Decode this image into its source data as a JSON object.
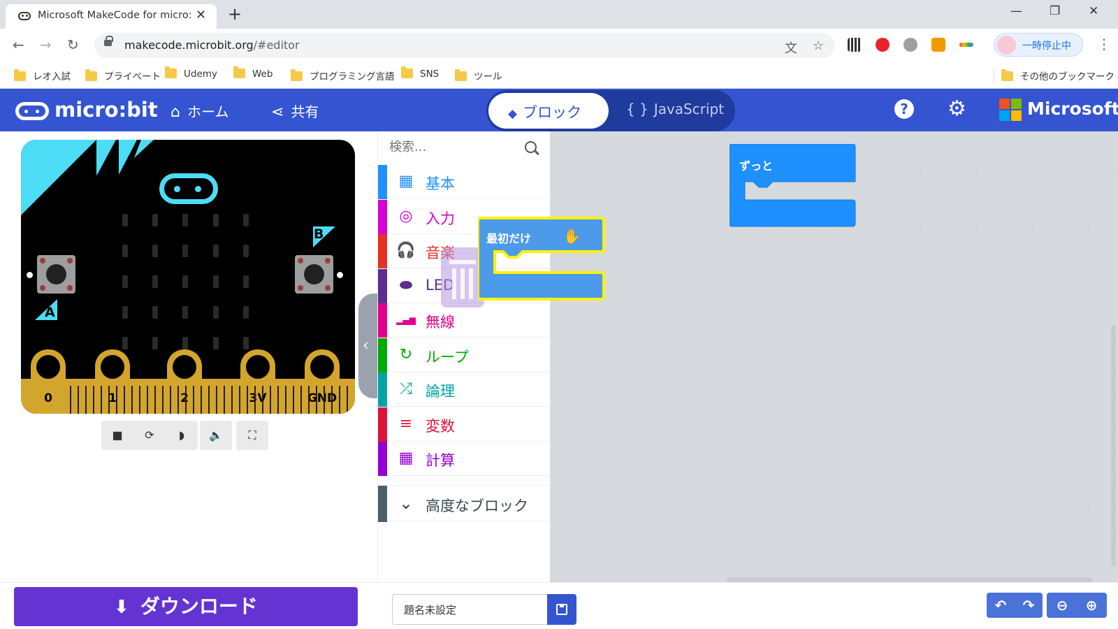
{
  "browser": {
    "tab_title": "Microsoft MakeCode for micro:bit",
    "new_tab": "+",
    "url_host": "makecode.microbit.org",
    "url_path": "/#editor",
    "profile_label": "一時停止中",
    "bookmarks": [
      "レオ入試",
      "プライベート",
      "Udemy",
      "Web",
      "プログラミング言語",
      "SNS",
      "ツール"
    ],
    "other_bookmarks": "その他のブックマーク"
  },
  "header": {
    "logo_text": "micro:bit",
    "home": "ホーム",
    "share": "共有",
    "mode_blocks": "ブロック",
    "mode_js": "JavaScript",
    "microsoft": "Microsoft",
    "help": "?",
    "colors": {
      "header_bg": "#3454d1"
    }
  },
  "simulator": {
    "btn_a": "A",
    "btn_b": "B",
    "pins": [
      "0",
      "1",
      "2",
      "3V",
      "GND"
    ],
    "accent": "#4ddcf5"
  },
  "toolbox": {
    "search_placeholder": "検索...",
    "categories": [
      {
        "label": "基本",
        "color": "#1e90ff",
        "icon": "grid-icon"
      },
      {
        "label": "入力",
        "color": "#d400d4",
        "icon": "target-icon"
      },
      {
        "label": "音楽",
        "color": "#e63022",
        "icon": "headphones-icon"
      },
      {
        "label": "LED",
        "color": "#5c2d91",
        "icon": "toggle-icon"
      },
      {
        "label": "無線",
        "color": "#e3008c",
        "icon": "signal-icon"
      },
      {
        "label": "ループ",
        "color": "#00aa00",
        "icon": "loop-icon"
      },
      {
        "label": "論理",
        "color": "#00a4a6",
        "icon": "shuffle-icon"
      },
      {
        "label": "変数",
        "color": "#dc143c",
        "icon": "lines-icon"
      },
      {
        "label": "計算",
        "color": "#9400d3",
        "icon": "calculator-icon"
      }
    ],
    "advanced": "高度なブロック"
  },
  "workspace": {
    "forever_label": "ずっと",
    "on_start_label": "最初だけ",
    "block_color": "#1e90ff",
    "highlight": "#fff200"
  },
  "bottom": {
    "download": "ダウンロード",
    "project_name": "題名未設定"
  }
}
